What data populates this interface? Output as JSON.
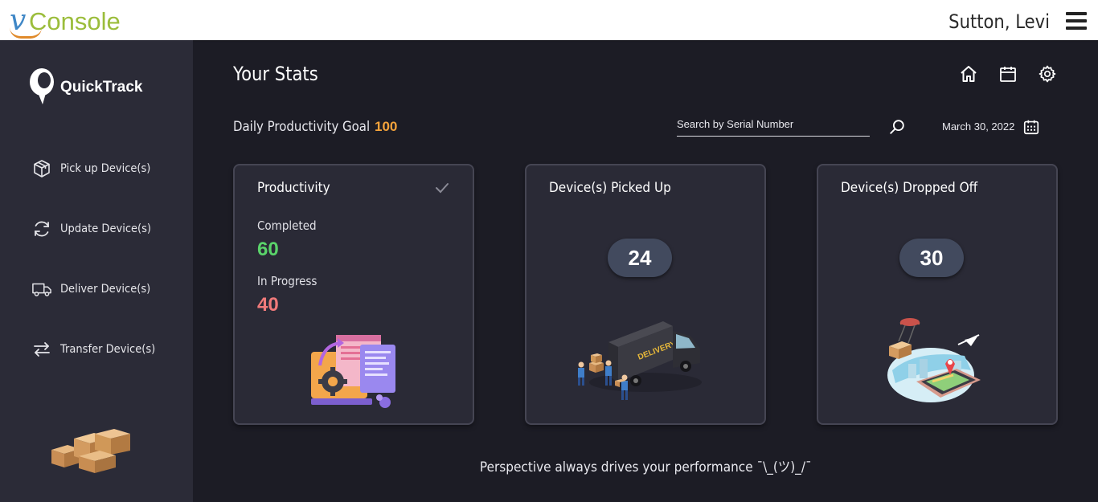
{
  "app": {
    "logo_text": "vConsole",
    "user_name": "Sutton, Levi"
  },
  "sidebar": {
    "brand": "QuickTrack",
    "items": [
      {
        "label": "Pick up Device(s)",
        "icon": "box-icon"
      },
      {
        "label": "Update Device(s)",
        "icon": "refresh-icon"
      },
      {
        "label": "Deliver Device(s)",
        "icon": "truck-icon"
      },
      {
        "label": "Transfer Device(s)",
        "icon": "transfer-icon"
      }
    ]
  },
  "header": {
    "title": "Your Stats",
    "icons": [
      "home-icon",
      "calendar-icon",
      "settings-icon"
    ]
  },
  "goal": {
    "label": "Daily Productivity Goal",
    "value": "100"
  },
  "search": {
    "placeholder": "Search by Serial Number",
    "value": ""
  },
  "date": {
    "value": "March  30, 2022"
  },
  "cards": {
    "productivity": {
      "title": "Productivity",
      "completed_label": "Completed",
      "completed_value": "60",
      "in_progress_label": "In Progress",
      "in_progress_value": "40"
    },
    "picked_up": {
      "title": "Device(s) Picked Up",
      "value": "24"
    },
    "dropped_off": {
      "title": "Device(s) Dropped Off",
      "value": "30"
    }
  },
  "tagline": "Perspective always drives your performance ¯\\_(ツ)_/¯",
  "colors": {
    "accent_orange": "#f5a33b",
    "completed_green": "#5ad36a",
    "in_progress_red": "#f07a7a",
    "background": "#1c1c25",
    "sidebar": "#2b2b37"
  }
}
